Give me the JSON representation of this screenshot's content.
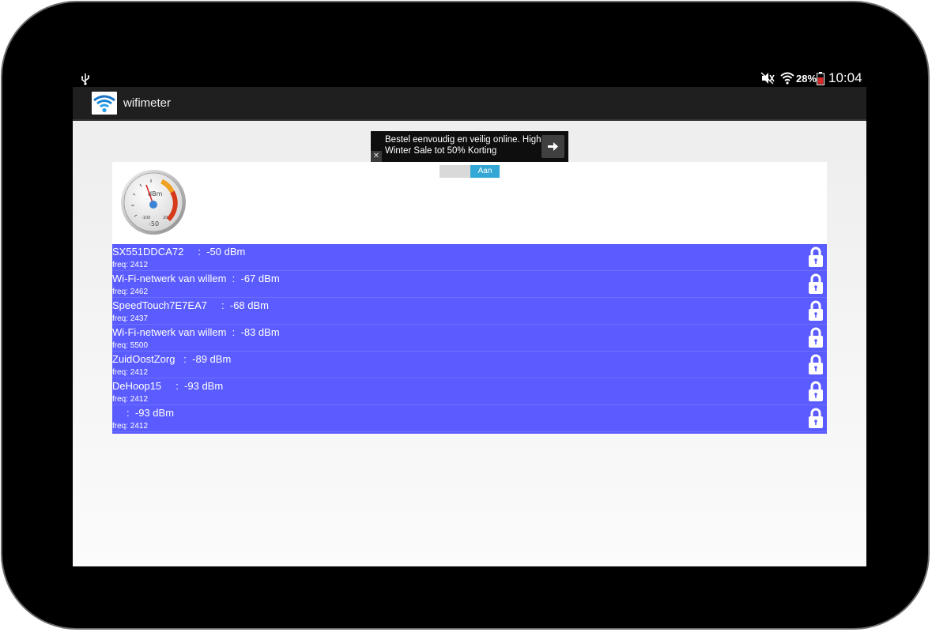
{
  "status_bar": {
    "battery_percent": "28%",
    "time": "10:04",
    "icons": [
      "usb-icon",
      "mute-icon",
      "wifi-icon",
      "battery-icon"
    ]
  },
  "action_bar": {
    "title": "wifimeter",
    "icon": "wifi-app-icon"
  },
  "ad": {
    "text": "Bestel eenvoudig en veilig online. High Winter Sale tot 50% Korting",
    "close_label": "✕",
    "arrow_icon": "arrow-right-icon"
  },
  "toggle": {
    "on_label": "Aan"
  },
  "gauge": {
    "unit": "dBm",
    "reading": "-50",
    "min_label": "-100",
    "max_label": "20"
  },
  "networks": [
    {
      "main": "SX551DDCA72     :  -50 dBm",
      "freq": "freq: 2412"
    },
    {
      "main": "Wi-Fi-netwerk van willem  :  -67 dBm",
      "freq": "freq: 2462"
    },
    {
      "main": "SpeedTouch7E7EA7     :  -68 dBm",
      "freq": "freq: 2437"
    },
    {
      "main": "Wi-Fi-netwerk van willem  :  -83 dBm",
      "freq": "freq: 5500"
    },
    {
      "main": "ZuidOostZorg   :  -89 dBm",
      "freq": "freq: 2412"
    },
    {
      "main": "DeHoop15     :  -93 dBm",
      "freq": "freq: 2412"
    },
    {
      "main": "     :  -93 dBm",
      "freq": "freq: 2412"
    }
  ],
  "colors": {
    "list_background": "#5b5cff",
    "toggle_on": "#33a7d5",
    "action_bar": "#1f1f1f"
  }
}
